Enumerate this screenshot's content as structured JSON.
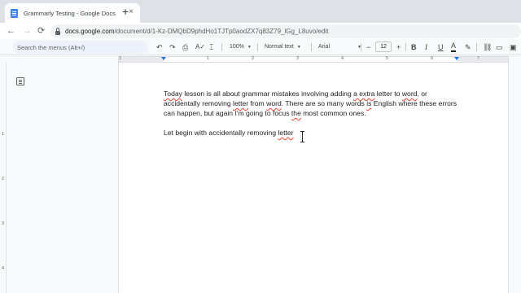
{
  "tab": {
    "title": "Grammarly Testing - Google Docs",
    "close": "×",
    "new_tab": "+"
  },
  "nav": {
    "back": "←",
    "forward": "→",
    "reload": "⟳",
    "url_host": "docs.google.com",
    "url_path": "/document/d/1-Kz-DMQbD9phdHo1TJTp0aodZX7q83Z79_lGg_L8uvo/edit"
  },
  "toolbar": {
    "search_placeholder": "Search the menus (Alt+/)",
    "zoom": "100%",
    "style": "Normal text",
    "font": "Arial",
    "font_size": "12",
    "minus": "−",
    "plus": "+",
    "bold": "B",
    "italic": "I",
    "underline": "U",
    "text_color": "A"
  },
  "ruler": {
    "h_numbers": [
      "1",
      "1",
      "2",
      "3",
      "4",
      "5",
      "6",
      "7"
    ],
    "v_numbers": [
      "1",
      "2",
      "3",
      "4"
    ]
  },
  "document": {
    "p1": [
      {
        "t": "Today",
        "err": true
      },
      {
        "t": " lesson is all about grammar mistakes involving adding ",
        "err": false
      },
      {
        "t": "a extra",
        "err": true
      },
      {
        "t": " letter to ",
        "err": false
      },
      {
        "t": "word",
        "err": true
      },
      {
        "t": ", or accidentally removing ",
        "err": false
      },
      {
        "t": "letter",
        "err": true
      },
      {
        "t": " from ",
        "err": false
      },
      {
        "t": "word",
        "err": true
      },
      {
        "t": ". There are so many words ",
        "err": false
      },
      {
        "t": "is",
        "err": true
      },
      {
        "t": " English where these errors can happen, but again I'm going to focus ",
        "err": false
      },
      {
        "t": "the",
        "err": true
      },
      {
        "t": " most common ones.",
        "err": false
      }
    ],
    "p2": [
      {
        "t": "Let begin with accidentally removing ",
        "err": false
      },
      {
        "t": "letter",
        "err": true
      }
    ]
  },
  "colors": {
    "accent": "#1a73e8",
    "spelling_underline": "#ea4335"
  }
}
